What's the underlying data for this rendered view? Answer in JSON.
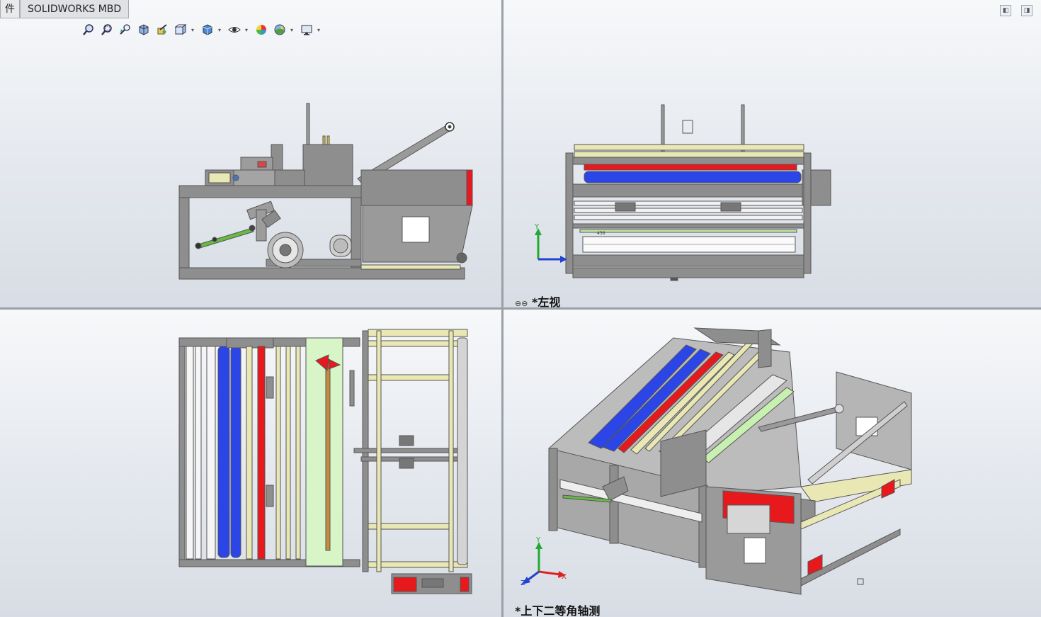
{
  "tabs": [
    {
      "label": "件",
      "active": false
    },
    {
      "label": "SOLIDWORKS MBD",
      "active": true
    }
  ],
  "toolbar": [
    {
      "icon": "zoom-to-fit-icon",
      "dropdown": false
    },
    {
      "icon": "zoom-to-area-icon",
      "dropdown": false
    },
    {
      "icon": "previous-view-icon",
      "dropdown": false
    },
    {
      "icon": "section-view-icon",
      "dropdown": false
    },
    {
      "icon": "dynamic-annotation-icon",
      "dropdown": false
    },
    {
      "icon": "view-orientation-icon",
      "dropdown": true
    },
    {
      "icon": "display-style-icon",
      "dropdown": true
    },
    {
      "icon": "hide-show-items-icon",
      "dropdown": true
    },
    {
      "icon": "edit-appearance-icon",
      "dropdown": false
    },
    {
      "icon": "apply-scene-icon",
      "dropdown": true
    },
    {
      "icon": "view-settings-icon",
      "dropdown": true
    }
  ],
  "views": {
    "top_right_label": "*左视",
    "bottom_right_label": "*上下二等角轴测"
  },
  "triad": {
    "x": "X",
    "y": "Y",
    "z": "Z"
  },
  "model_label": "456",
  "colors": {
    "frame": "#8e8e8e",
    "frame_dark": "#555555",
    "red": "#e8191d",
    "blue": "#2c45e6",
    "green": "#66bb44",
    "yellow": "#e9e8b4",
    "light_green": "#d8f5c8"
  }
}
